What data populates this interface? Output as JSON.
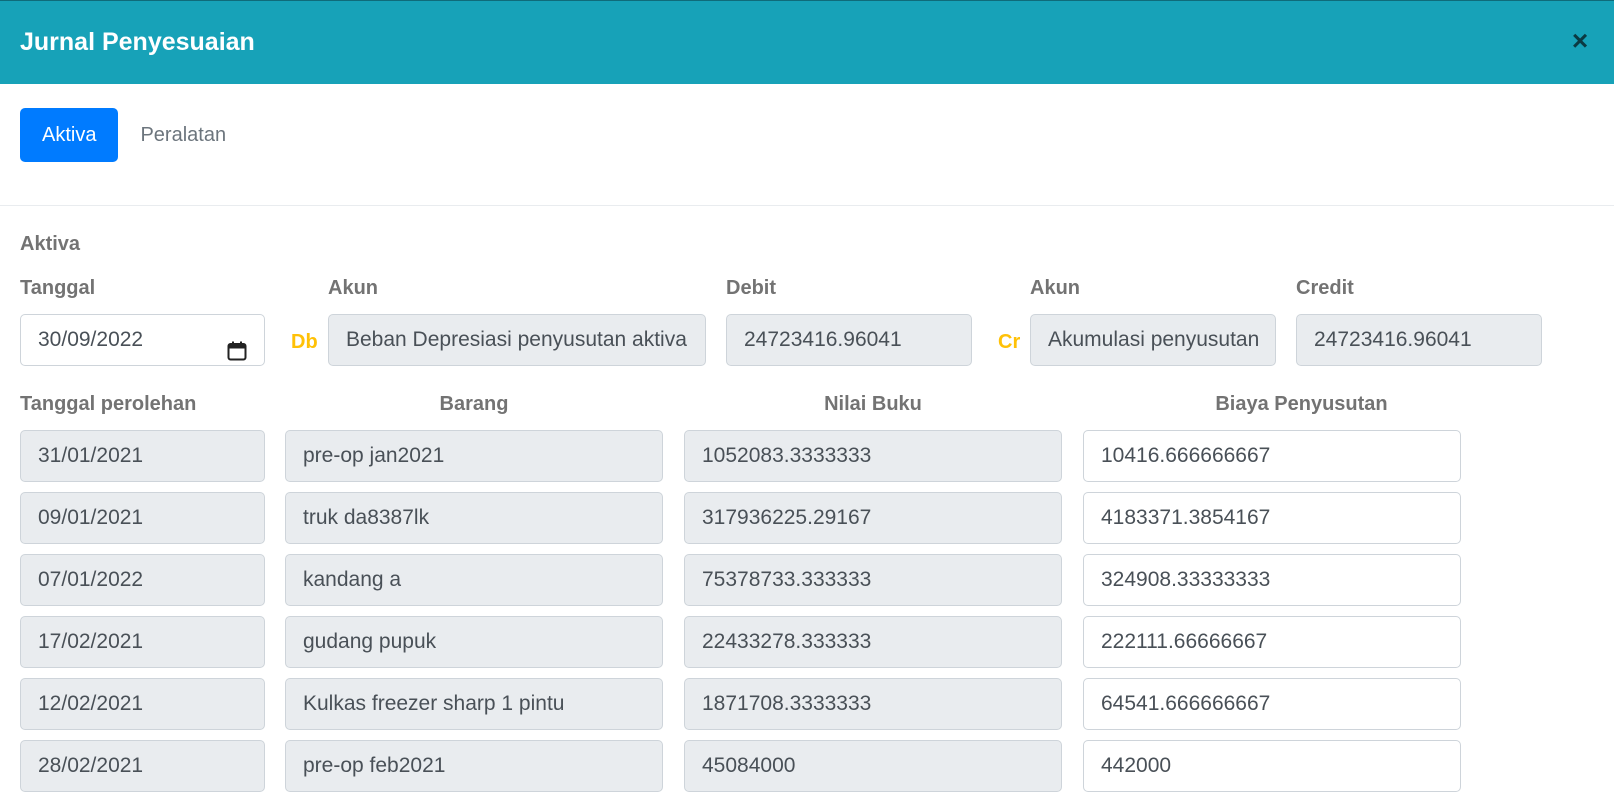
{
  "modal": {
    "title": "Jurnal Penyesuaian",
    "close_label": "×"
  },
  "tabs": [
    {
      "label": "Aktiva",
      "active": true
    },
    {
      "label": "Peralatan",
      "active": false
    }
  ],
  "section": {
    "heading": "Aktiva",
    "tanggal_label": "Tanggal",
    "tanggal_value": "30/09/2022",
    "debit_marker": "Db",
    "akun_debit_label": "Akun",
    "akun_debit_value": "Beban Depresiasi penyusutan aktiva",
    "debit_label": "Debit",
    "debit_value": "24723416.96041",
    "credit_marker": "Cr",
    "akun_credit_label": "Akun",
    "akun_credit_value": "Akumulasi penyusutan",
    "credit_label": "Credit",
    "credit_value": "24723416.96041"
  },
  "table": {
    "headers": [
      "Tanggal perolehan",
      "Barang",
      "Nilai Buku",
      "Biaya Penyusutan"
    ],
    "rows": [
      {
        "tanggal": "31/01/2021",
        "barang": "pre-op jan2021",
        "nilai_buku": "1052083.3333333",
        "biaya": "10416.666666667"
      },
      {
        "tanggal": "09/01/2021",
        "barang": "truk da8387lk",
        "nilai_buku": "317936225.29167",
        "biaya": "4183371.3854167"
      },
      {
        "tanggal": "07/01/2022",
        "barang": "kandang a",
        "nilai_buku": "75378733.333333",
        "biaya": "324908.33333333"
      },
      {
        "tanggal": "17/02/2021",
        "barang": "gudang pupuk",
        "nilai_buku": "22433278.333333",
        "biaya": "222111.66666667"
      },
      {
        "tanggal": "12/02/2021",
        "barang": "Kulkas freezer sharp 1 pintu",
        "nilai_buku": "1871708.3333333",
        "biaya": "64541.666666667"
      },
      {
        "tanggal": "28/02/2021",
        "barang": "pre-op feb2021",
        "nilai_buku": "45084000",
        "biaya": "442000"
      }
    ]
  },
  "colors": {
    "header_bg": "#17a2b8",
    "tab_active": "#007bff",
    "marker": "#ffc107"
  },
  "icons": {
    "close": "close-icon",
    "calendar": "calendar-icon"
  }
}
